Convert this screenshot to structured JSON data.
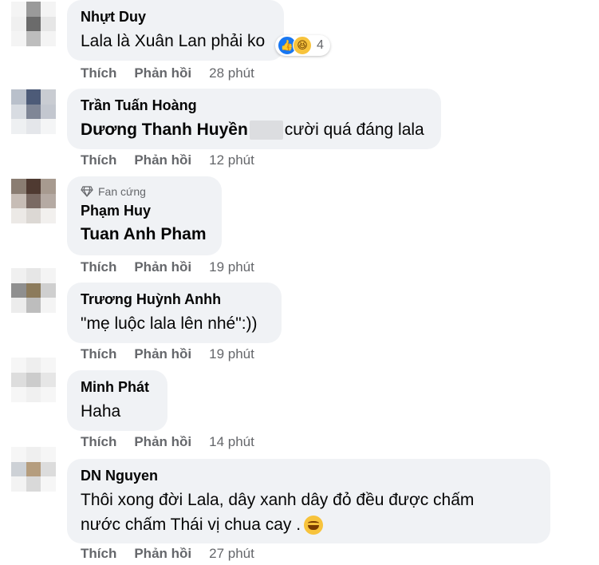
{
  "labels": {
    "like": "Thích",
    "reply": "Phản hồi"
  },
  "comments": [
    {
      "name": "Nhựt Duy",
      "text": "Lala là Xuân Lan phải ko",
      "time": "28 phút",
      "reaction_count": "4",
      "avatar": [
        "#f4f4f4",
        "#9a9a9a",
        "#f4f4f4",
        "#f0f0f0",
        "#6b6b6b",
        "#e6e6e6",
        "#f4f4f4",
        "#bdbdbd",
        "#f4f4f4"
      ]
    },
    {
      "name": "Trần Tuấn Hoàng",
      "text_a": "Dương Thanh Huyền",
      "text_b": "cười quá đáng lala",
      "time": "12 phút",
      "avatar": [
        "#b9c0cb",
        "#4d5b78",
        "#c9ccd2",
        "#d8dce2",
        "#7f8696",
        "#c3c7cf",
        "#eef0f2",
        "#e4e6ea",
        "#f4f5f6"
      ]
    },
    {
      "badge": "Fan cứng",
      "name": "Phạm Huy",
      "text": "Tuan Anh Pham",
      "time": "19 phút",
      "avatar": [
        "#8a7d72",
        "#4f3a31",
        "#a79a8f",
        "#c7bdb6",
        "#7a6a63",
        "#b5aaa3",
        "#ece9e6",
        "#dcd8d4",
        "#f2f0ee"
      ]
    },
    {
      "name": "Trương Huỳnh Anhh",
      "text": "\"mẹ luộc lala lên nhé\":))",
      "time": "19 phút",
      "avatar": [
        "#f0f0f0",
        "#e6e6e6",
        "#f4f4f4",
        "#8f8f8f",
        "#8c7b5c",
        "#cfcfcf",
        "#ececec",
        "#bdbdbd",
        "#f4f4f4"
      ]
    },
    {
      "name": "Minh Phát",
      "text": "Haha",
      "time": "14 phút",
      "avatar": [
        "#f6f6f6",
        "#eeeeee",
        "#f6f6f6",
        "#dddddd",
        "#cccccc",
        "#e6e6e6",
        "#f6f6f6",
        "#f0f0f0",
        "#f6f6f6"
      ]
    },
    {
      "name": "DN Nguyen",
      "text_line1": "Thôi xong đời Lala, dây xanh dây đỏ đều được chấm",
      "text_line2": "nước chấm Thái vị chua cay .",
      "time": "27 phút",
      "avatar": [
        "#f6f6f6",
        "#efefef",
        "#f6f6f6",
        "#cdd1d6",
        "#b59d7e",
        "#dcdcdc",
        "#f3f3f3",
        "#d9d9d9",
        "#f6f6f6"
      ]
    }
  ]
}
